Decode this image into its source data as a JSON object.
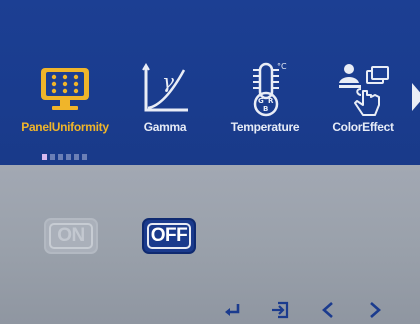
{
  "menu": {
    "items": [
      {
        "label": "PanelUniformity",
        "icon": "panel-uniformity-icon",
        "selected": true
      },
      {
        "label": "Gamma",
        "icon": "gamma-icon",
        "selected": false
      },
      {
        "label": "Temperature",
        "icon": "thermometer-icon",
        "selected": false
      },
      {
        "label": "ColorEffect",
        "icon": "color-effect-icon",
        "selected": false
      }
    ],
    "more_icon": "arrow-right-icon",
    "page_indicator": {
      "total": 6,
      "current": 1
    }
  },
  "options": {
    "on_label": "ON",
    "off_label": "OFF",
    "current": "OFF"
  },
  "nav": {
    "buttons": [
      "enter-icon",
      "exit-icon",
      "chevron-left-icon",
      "chevron-right-icon"
    ]
  },
  "colors": {
    "menu_band": "#1c3f93",
    "selected": "#f0b52a",
    "content_bg": "#9aa1ab"
  }
}
